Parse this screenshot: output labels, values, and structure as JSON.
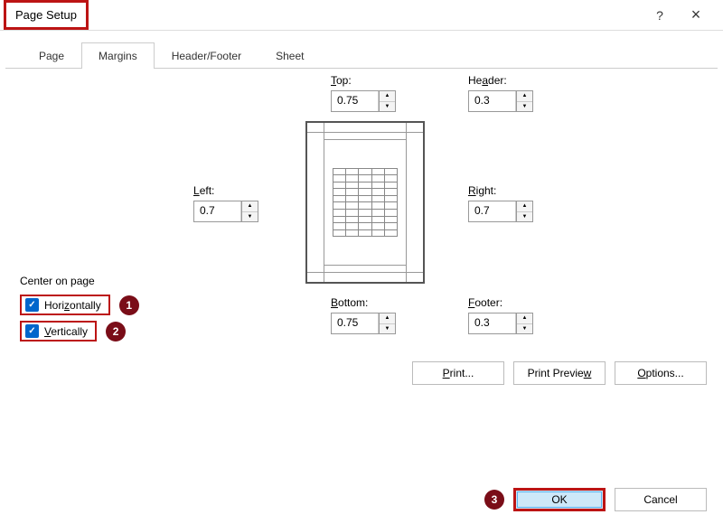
{
  "title": "Page Setup",
  "tabs": {
    "page": "Page",
    "margins": "Margins",
    "headerfooter": "Header/Footer",
    "sheet": "Sheet",
    "active": "margins"
  },
  "margins": {
    "top_label": "Top:",
    "top": "0.75",
    "header_label": "Header:",
    "header": "0.3",
    "left_label": "Left:",
    "left": "0.7",
    "right_label": "Right:",
    "right": "0.7",
    "bottom_label": "Bottom:",
    "bottom": "0.75",
    "footer_label": "Footer:",
    "footer": "0.3"
  },
  "center": {
    "label": "Center on page",
    "horizontally": "Horizontally",
    "vertically": "Vertically"
  },
  "buttons": {
    "print": "Print...",
    "preview": "Print Preview",
    "options": "Options...",
    "ok": "OK",
    "cancel": "Cancel"
  },
  "annotations": {
    "b1": "1",
    "b2": "2",
    "b3": "3"
  }
}
